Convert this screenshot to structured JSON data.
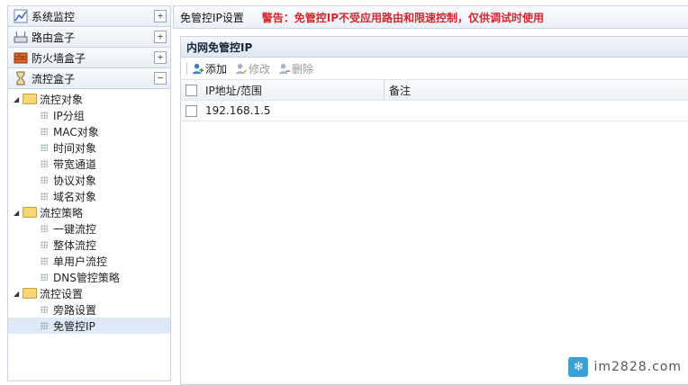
{
  "sidebar": {
    "sections": [
      {
        "label": "系统监控",
        "toggle": "+",
        "icon": "chart-icon"
      },
      {
        "label": "路由盒子",
        "toggle": "+",
        "icon": "router-icon"
      },
      {
        "label": "防火墙盒子",
        "toggle": "+",
        "icon": "firewall-icon"
      },
      {
        "label": "流控盒子",
        "toggle": "−",
        "icon": "hourglass-icon"
      }
    ],
    "tree": [
      {
        "label": "流控对象",
        "children": [
          "IP分组",
          "MAC对象",
          "时间对象",
          "带宽通道",
          "协议对象",
          "域名对象"
        ]
      },
      {
        "label": "流控策略",
        "children": [
          "一键流控",
          "整体流控",
          "单用户流控",
          "DNS管控策略"
        ]
      },
      {
        "label": "流控设置",
        "children": [
          "旁路设置",
          "免管控IP"
        ]
      }
    ],
    "selected": "免管控IP"
  },
  "header": {
    "title": "免管控IP设置",
    "warning": "警告：免管控IP不受应用路由和限速控制，仅供调试时使用"
  },
  "panel": {
    "title": "内网免管控IP",
    "toolbar": {
      "add": "添加",
      "edit": "修改",
      "delete": "删除"
    },
    "columns": {
      "ip": "IP地址/范围",
      "note": "备注"
    },
    "rows": [
      {
        "ip": "192.168.1.5",
        "note": ""
      }
    ]
  },
  "watermark": "im2828.com"
}
